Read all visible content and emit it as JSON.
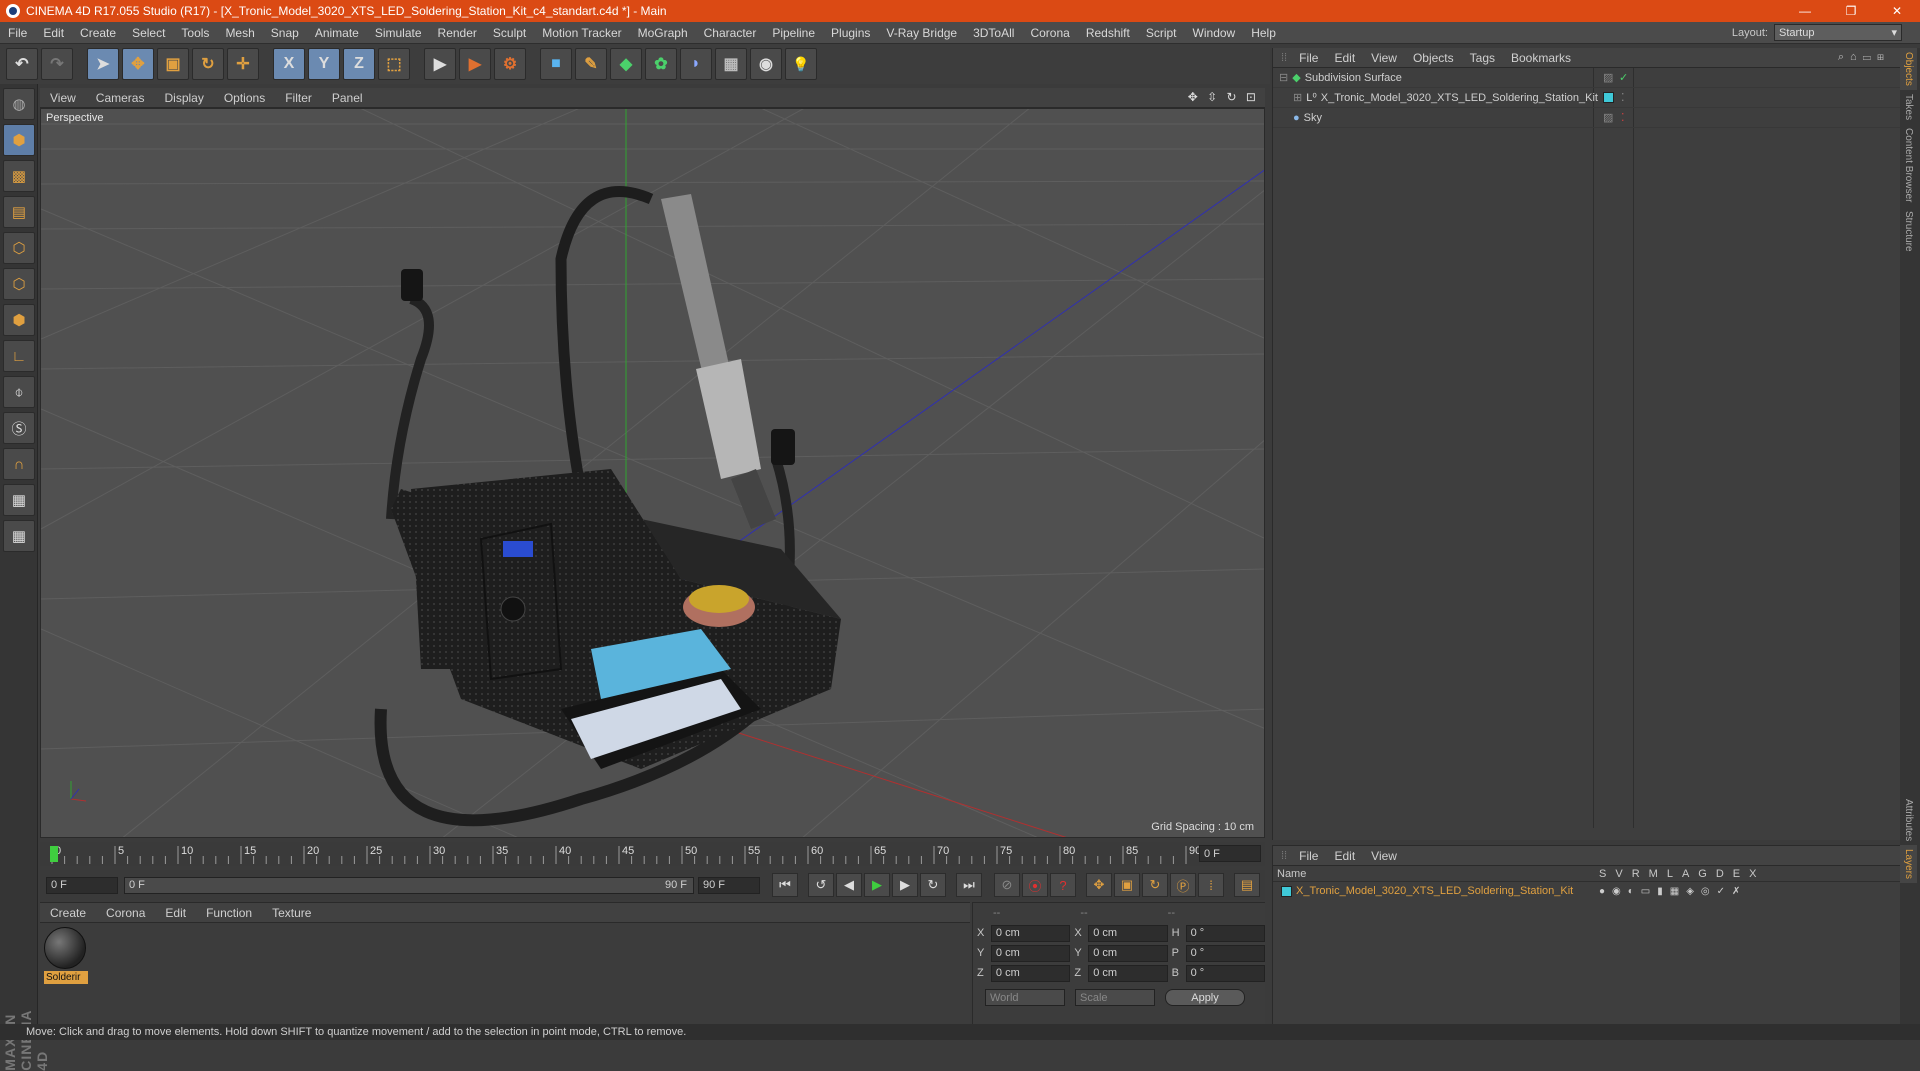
{
  "window": {
    "title": "CINEMA 4D R17.055 Studio (R17) - [X_Tronic_Model_3020_XTS_LED_Soldering_Station_Kit_c4_standart.c4d *] - Main",
    "minimize": "—",
    "restore": "❐",
    "close": "✕"
  },
  "menubar": {
    "items": [
      "File",
      "Edit",
      "Create",
      "Select",
      "Tools",
      "Mesh",
      "Snap",
      "Animate",
      "Simulate",
      "Render",
      "Sculpt",
      "Motion Tracker",
      "MoGraph",
      "Character",
      "Pipeline",
      "Plugins",
      "V-Ray Bridge",
      "3DToAll",
      "Corona",
      "Redshift",
      "Script",
      "Window",
      "Help"
    ],
    "layout_label": "Layout:",
    "layout_value": "Startup"
  },
  "toolbar": {
    "undo": "↶",
    "redo": "↷",
    "select": "➤",
    "move": "✥",
    "scale": "▣",
    "rotate": "↻",
    "transform": "✛",
    "axis_x": "X",
    "axis_y": "Y",
    "axis_z": "Z",
    "coord": "⬚",
    "render_view": "▶",
    "render_pv": "▶",
    "render_settings": "⚙",
    "cube": "■",
    "pen": "✎",
    "subdiv": "◆",
    "array": "✿",
    "deformer": "◗",
    "floor": "▦",
    "camera": "◉",
    "light": "💡"
  },
  "viewport": {
    "menu": [
      "View",
      "Cameras",
      "Display",
      "Options",
      "Filter",
      "Panel"
    ],
    "nav_icons": "✥ ⇳ ↻ ⊡",
    "label": "Perspective",
    "grid_spacing": "Grid Spacing : 10 cm"
  },
  "timeline": {
    "ticks": [
      "0",
      "5",
      "10",
      "15",
      "20",
      "25",
      "30",
      "35",
      "40",
      "45",
      "50",
      "55",
      "60",
      "65",
      "70",
      "75",
      "80",
      "85",
      "90"
    ],
    "current_frame": "0 F",
    "start_field": "0 F",
    "range_start": "0 F",
    "range_end": "90 F",
    "end_field": "90 F"
  },
  "material_panel": {
    "menu": [
      "Create",
      "Corona",
      "Edit",
      "Function",
      "Texture"
    ],
    "material_name": "Solderir"
  },
  "coords": {
    "headers": [
      "--",
      "--",
      "--"
    ],
    "rows": [
      {
        "a": "X",
        "av": "0 cm",
        "b": "X",
        "bv": "0 cm",
        "c": "H",
        "cv": "0 °"
      },
      {
        "a": "Y",
        "av": "0 cm",
        "b": "Y",
        "bv": "0 cm",
        "c": "P",
        "cv": "0 °"
      },
      {
        "a": "Z",
        "av": "0 cm",
        "b": "Z",
        "bv": "0 cm",
        "c": "B",
        "cv": "0 °"
      }
    ],
    "mode1": "World",
    "mode2": "Scale",
    "apply": "Apply"
  },
  "objects_panel": {
    "menu": [
      "File",
      "Edit",
      "View",
      "Objects",
      "Tags",
      "Bookmarks"
    ],
    "items": [
      {
        "name": "Subdivision Surface",
        "color": "#4bd06b"
      },
      {
        "name": "X_Tronic_Model_3020_XTS_LED_Soldering_Station_Kit",
        "color": "#cfcfcf"
      },
      {
        "name": "Sky",
        "color": "#cfcfcf"
      }
    ]
  },
  "layers_panel": {
    "menu": [
      "File",
      "Edit",
      "View"
    ],
    "header_name": "Name",
    "columns": [
      "S",
      "V",
      "R",
      "M",
      "L",
      "A",
      "G",
      "D",
      "E",
      "X"
    ],
    "layer_name": "X_Tronic_Model_3020_XTS_LED_Soldering_Station_Kit",
    "layer_color": "#3fc9d8"
  },
  "right_tabs": [
    "Objects",
    "Takes",
    "Content Browser",
    "Structure",
    "Attributes",
    "Layers"
  ],
  "left_brand": "MAXON CINEMA 4D",
  "status": "Move: Click and drag to move elements. Hold down SHIFT to quantize movement / add to the selection in point mode, CTRL to remove.",
  "colors": {
    "accent": "#db4a14",
    "selection": "#e0a040",
    "panel": "#3e3e3e"
  }
}
